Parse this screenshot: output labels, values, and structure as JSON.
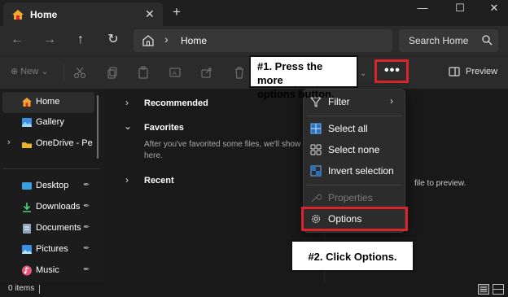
{
  "window": {
    "tab_title": "Home",
    "tab_close": "✕",
    "new_tab": "+",
    "minimize": "—",
    "maximize": "☐",
    "close": "✕"
  },
  "nav": {
    "back": "←",
    "forward": "→",
    "up": "↑",
    "refresh": "↻"
  },
  "address": {
    "separator": "›",
    "location": "Home"
  },
  "search": {
    "placeholder": "Search Home"
  },
  "toolbar": {
    "new_label": "⊕ New ⌄",
    "more_label": "•••",
    "preview_label": "Preview",
    "chevron": "⌄"
  },
  "sidebar": {
    "items": [
      {
        "label": "Home",
        "icon": "home-icon"
      },
      {
        "label": "Gallery",
        "icon": "gallery-icon"
      },
      {
        "label": "OneDrive - Perso",
        "icon": "onedrive-icon",
        "expand": "›"
      },
      {
        "label": "Desktop",
        "icon": "desktop-icon",
        "pin": "📌"
      },
      {
        "label": "Downloads",
        "icon": "downloads-icon",
        "pin": "📌"
      },
      {
        "label": "Documents",
        "icon": "documents-icon",
        "pin": "📌"
      },
      {
        "label": "Pictures",
        "icon": "pictures-icon",
        "pin": "📌"
      },
      {
        "label": "Music",
        "icon": "music-icon",
        "pin": "📌"
      }
    ]
  },
  "main": {
    "recommended": "Recommended",
    "favorites": "Favorites",
    "favorites_empty": "After you've favorited some files, we'll show them here.",
    "recent": "Recent",
    "chev_right": "›",
    "chev_down": "⌄",
    "preview_hint": "file to preview."
  },
  "menu": {
    "items": [
      {
        "label": "Filter",
        "icon": "filter-icon",
        "arrow": "›"
      },
      {
        "label": "Select all",
        "icon": "select-all-icon"
      },
      {
        "label": "Select none",
        "icon": "select-none-icon"
      },
      {
        "label": "Invert selection",
        "icon": "invert-selection-icon"
      },
      {
        "label": "Properties",
        "icon": "properties-icon",
        "disabled": true
      },
      {
        "label": "Options",
        "icon": "options-gear-icon"
      }
    ]
  },
  "callouts": {
    "step1_line1": "#1. Press the more",
    "step1_line2": "options button.",
    "step2": "#2. Click Options."
  },
  "status": {
    "items_count": "0 items"
  },
  "colors": {
    "highlight_red": "#d9242c",
    "background": "#191919",
    "accent_blue": "#4cc2ff"
  }
}
